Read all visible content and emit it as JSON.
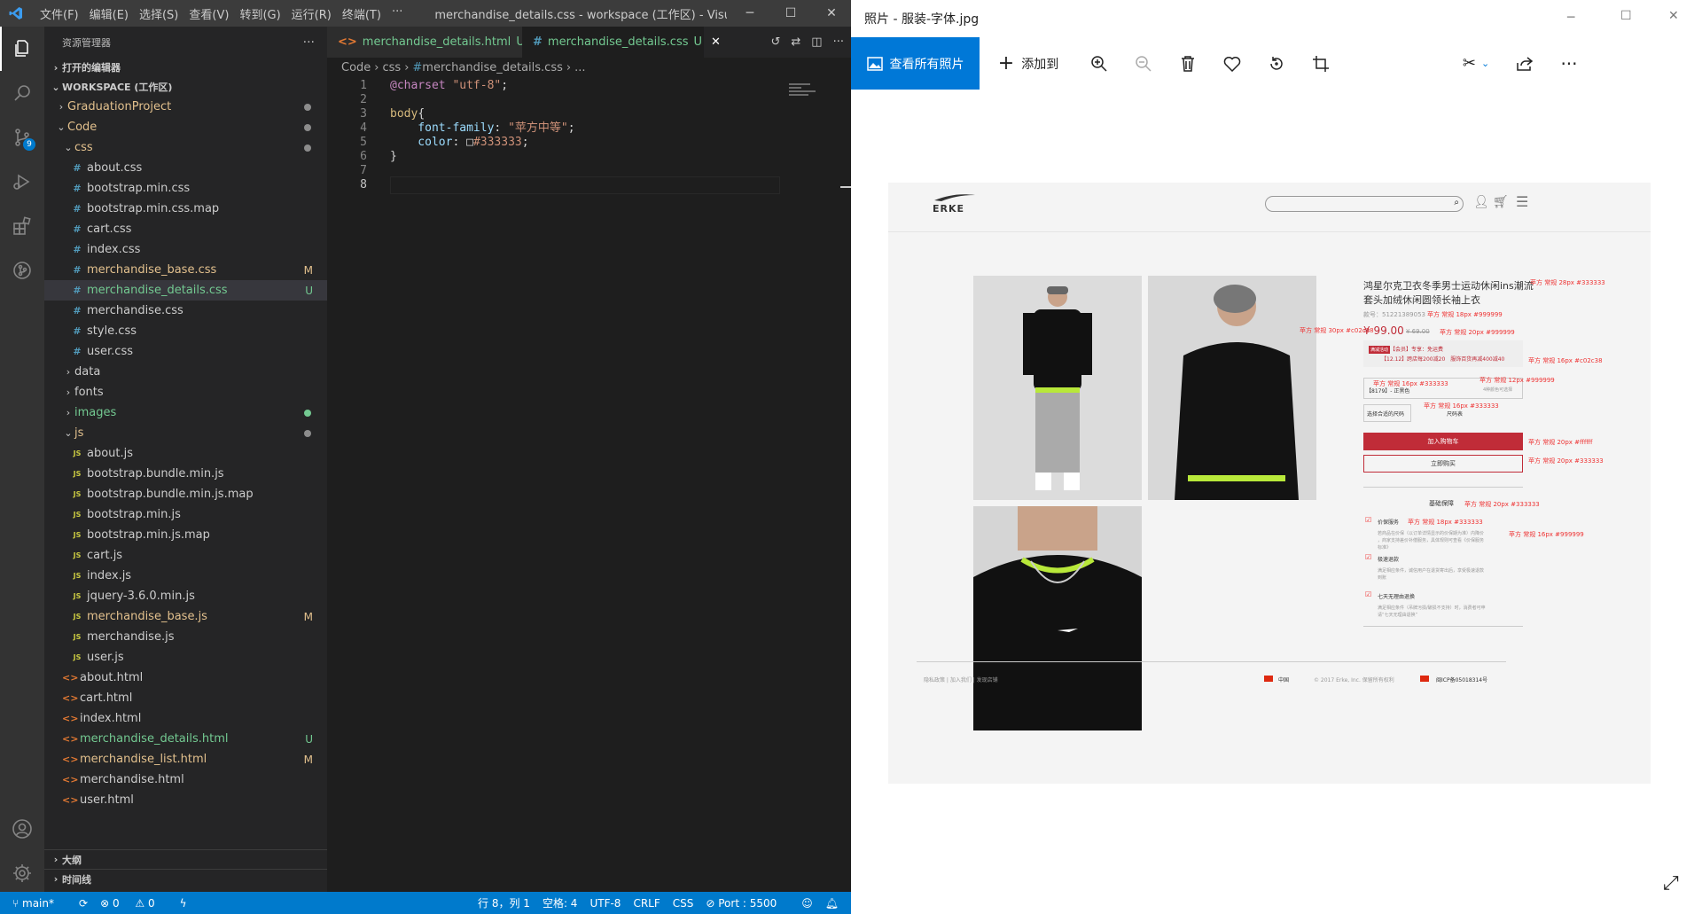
{
  "vscode": {
    "menu": [
      "文件(F)",
      "编辑(E)",
      "选择(S)",
      "查看(V)",
      "转到(G)",
      "运行(R)",
      "终端(T)",
      "···"
    ],
    "window_title": "merchandise_details.css - workspace (工作区) - Visual St...",
    "sidebar": {
      "header": "资源管理器",
      "open_editors": "打开的编辑器",
      "workspace": "WORKSPACE (工作区)",
      "tree": [
        {
          "label": "GraduationProject",
          "type": "folder",
          "indent": 1,
          "open": false,
          "color": "mod",
          "dot": "#8c8c8c"
        },
        {
          "label": "Code",
          "type": "folder",
          "indent": 1,
          "open": true,
          "color": "mod",
          "dot": "#8c8c8c"
        },
        {
          "label": "css",
          "type": "folder",
          "indent": 2,
          "open": true,
          "color": "mod",
          "dot": "#8c8c8c"
        },
        {
          "label": "about.css",
          "type": "css",
          "indent": 3
        },
        {
          "label": "bootstrap.min.css",
          "type": "css",
          "indent": 3
        },
        {
          "label": "bootstrap.min.css.map",
          "type": "css",
          "indent": 3
        },
        {
          "label": "cart.css",
          "type": "css",
          "indent": 3
        },
        {
          "label": "index.css",
          "type": "css",
          "indent": 3
        },
        {
          "label": "merchandise_base.css",
          "type": "css",
          "indent": 3,
          "color": "mod",
          "status": "M"
        },
        {
          "label": "merchandise_details.css",
          "type": "css",
          "indent": 3,
          "color": "unt",
          "status": "U",
          "selected": true
        },
        {
          "label": "merchandise.css",
          "type": "css",
          "indent": 3
        },
        {
          "label": "style.css",
          "type": "css",
          "indent": 3
        },
        {
          "label": "user.css",
          "type": "css",
          "indent": 3
        },
        {
          "label": "data",
          "type": "folder",
          "indent": 2,
          "open": false
        },
        {
          "label": "fonts",
          "type": "folder",
          "indent": 2,
          "open": false
        },
        {
          "label": "images",
          "type": "folder",
          "indent": 2,
          "open": false,
          "color": "unt",
          "dot": "#73c991"
        },
        {
          "label": "js",
          "type": "folder",
          "indent": 2,
          "open": true,
          "color": "mod",
          "dot": "#8c8c8c"
        },
        {
          "label": "about.js",
          "type": "js",
          "indent": 3
        },
        {
          "label": "bootstrap.bundle.min.js",
          "type": "js",
          "indent": 3
        },
        {
          "label": "bootstrap.bundle.min.js.map",
          "type": "js",
          "indent": 3
        },
        {
          "label": "bootstrap.min.js",
          "type": "js",
          "indent": 3
        },
        {
          "label": "bootstrap.min.js.map",
          "type": "js",
          "indent": 3
        },
        {
          "label": "cart.js",
          "type": "js",
          "indent": 3
        },
        {
          "label": "index.js",
          "type": "js",
          "indent": 3
        },
        {
          "label": "jquery-3.6.0.min.js",
          "type": "js",
          "indent": 3
        },
        {
          "label": "merchandise_base.js",
          "type": "js",
          "indent": 3,
          "color": "mod",
          "status": "M"
        },
        {
          "label": "merchandise.js",
          "type": "js",
          "indent": 3
        },
        {
          "label": "user.js",
          "type": "js",
          "indent": 3
        },
        {
          "label": "about.html",
          "type": "html",
          "indent": 2
        },
        {
          "label": "cart.html",
          "type": "html",
          "indent": 2
        },
        {
          "label": "index.html",
          "type": "html",
          "indent": 2
        },
        {
          "label": "merchandise_details.html",
          "type": "html",
          "indent": 2,
          "color": "unt",
          "status": "U"
        },
        {
          "label": "merchandise_list.html",
          "type": "html",
          "indent": 2,
          "color": "mod",
          "status": "M"
        },
        {
          "label": "merchandise.html",
          "type": "html",
          "indent": 2
        },
        {
          "label": "user.html",
          "type": "html",
          "indent": 2
        }
      ],
      "outline": "大纲",
      "timeline": "时间线"
    },
    "tabs": [
      {
        "label": "merchandise_details.html",
        "status": "U"
      },
      {
        "label": "merchandise_details.css",
        "status": "U"
      }
    ],
    "breadcrumb": [
      "Code",
      "css",
      "merchandise_details.css",
      "..."
    ],
    "code_lines": [
      {
        "n": "1",
        "parts": [
          [
            "@charset ",
            "#c586c0"
          ],
          [
            "\"utf-8\"",
            "#ce9178"
          ],
          [
            ";",
            "#d4d4d4"
          ]
        ]
      },
      {
        "n": "2",
        "parts": []
      },
      {
        "n": "3",
        "parts": [
          [
            "body",
            "#d7ba7d"
          ],
          [
            "{",
            "#d4d4d4"
          ]
        ]
      },
      {
        "n": "4",
        "parts": [
          [
            "    font-family",
            "#9cdcfe"
          ],
          [
            ": ",
            "#d4d4d4"
          ],
          [
            "\"苹方中等\"",
            "#ce9178"
          ],
          [
            ";",
            "#d4d4d4"
          ]
        ]
      },
      {
        "n": "5",
        "parts": [
          [
            "    color",
            "#9cdcfe"
          ],
          [
            ": ",
            "#d4d4d4"
          ],
          [
            "□",
            "#d4d4d4"
          ],
          [
            "#333333",
            "#ce9178"
          ],
          [
            ";",
            "#d4d4d4"
          ]
        ]
      },
      {
        "n": "6",
        "parts": [
          [
            "}",
            "#d4d4d4"
          ]
        ]
      },
      {
        "n": "7",
        "parts": []
      },
      {
        "n": "8",
        "parts": []
      }
    ],
    "status": {
      "branch": "main*",
      "errors": "0",
      "warnings": "0",
      "position": "行 8，列 1",
      "spaces": "空格: 4",
      "encoding": "UTF-8",
      "eol": "CRLF",
      "language": "CSS",
      "port": "Port : 5500"
    },
    "scm_badge": "9"
  },
  "photos": {
    "title": "照片 - 服装-字体.jpg",
    "view_all": "查看所有照片",
    "add_to": "添加到",
    "page": {
      "brand": "ERKE",
      "product_title_1": "鸿星尔克卫衣冬季男士运动休闲ins潮流",
      "product_title_2": "套头加绒休闲圆领长袖上衣",
      "sku": "款号：51221389053",
      "price": "¥ 99.00",
      "old_price": "¥ 69.00",
      "promo_tag": "满减活动",
      "promo_1": "【会员】专享：免运费",
      "promo_2": "【12.12】跨店每200减20　服饰百货再减400减40",
      "color_sel": "【8179】- 正黑色",
      "size_prompt": "选择合适的尺码",
      "size_chart": "尺码表",
      "add_cart": "加入购物车",
      "buy_now": "立即购买",
      "guarantee": "基础保障",
      "g1": "价保服务",
      "g1_desc_1": "若商品在价保（以订单详情显示的价保期为准）内降价",
      "g1_desc_2": "，商家支持差价补偿服务，具体规则可查看《价保服务",
      "g1_desc_3": "标准》",
      "g2": "极速退款",
      "g2_desc_1": "满足相应条件，诚信用户在退货寄出后，享受极速退款",
      "g2_desc_2": "到账",
      "g3": "七天无理由退换",
      "g3_desc_1": "满足相应条件（吊牌污损/破损不支持）时，消费者可申",
      "g3_desc_2": "请“七天无理由退换”",
      "footer_links": "隐私政策 | 加入我们 | 发现店铺",
      "footer_country": "中国",
      "footer_copy": "© 2017 Erke, Inc. 保留所有权利",
      "footer_icp": "闽ICP备05018314号",
      "ann": {
        "title": "苹方 常规 28px #333333",
        "sku": "苹方 常规 18px #999999",
        "price": "苹方 常规 30px #c02c38",
        "old": "苹方 常规 20px #999999",
        "promo": "苹方 常规 16px #c02c38",
        "color": "苹方 常规 16px #333333",
        "color_r": "苹方 常规 12px #999999",
        "color_note": "4种颜色可选择",
        "size": "苹方 常规 16px #333333",
        "cart": "苹方 常规 20px #ffffff",
        "buy": "苹方 常规 20px #333333",
        "guar": "苹方 常规 20px #333333",
        "g1": "苹方 常规 18px #333333",
        "gdesc": "苹方 常规 16px #999999"
      }
    }
  }
}
